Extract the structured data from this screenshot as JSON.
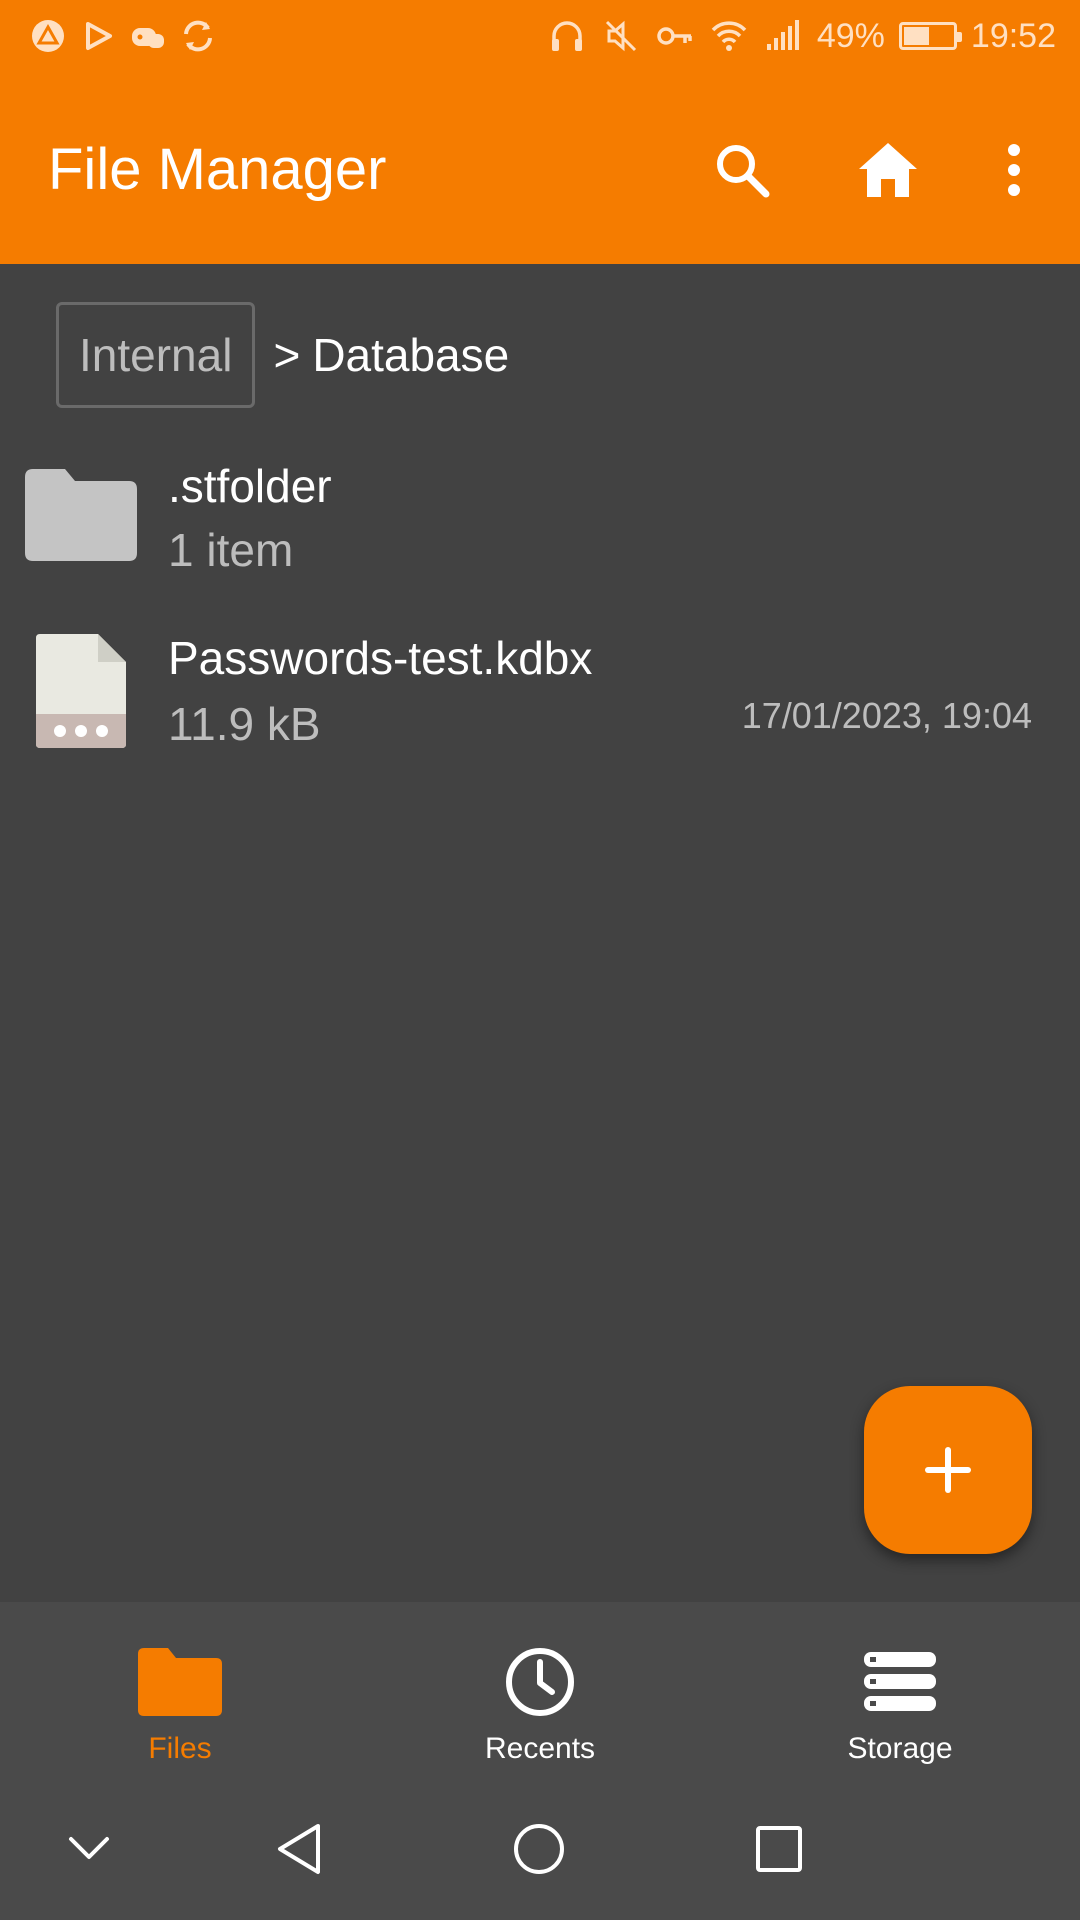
{
  "status_bar": {
    "battery_percent": "49%",
    "battery_level": 0.49,
    "time": "19:52",
    "left_icons": [
      "drive-icon",
      "play-icon",
      "game-icon",
      "sync-icon"
    ],
    "right_icons": [
      "headphones-icon",
      "mute-icon",
      "vpn-key-icon",
      "wifi-icon",
      "signal-icon",
      "battery-icon"
    ]
  },
  "app_bar": {
    "title": "File Manager",
    "actions": [
      "search-icon",
      "home-icon",
      "more-vert-icon"
    ],
    "color": "#F57C00"
  },
  "breadcrumb": {
    "root": "Internal",
    "separator": ">",
    "current": "Database"
  },
  "files": [
    {
      "name": ".stfolder",
      "meta": "1 item",
      "date": "",
      "icon": "folder-icon"
    },
    {
      "name": "Passwords-test.kdbx",
      "meta": "11.9 kB",
      "date": "17/01/2023, 19:04",
      "icon": "file-icon"
    }
  ],
  "fab": {
    "icon": "plus-icon"
  },
  "bottom_nav": {
    "items": [
      {
        "label": "Files",
        "icon": "folder-icon",
        "active": true
      },
      {
        "label": "Recents",
        "icon": "clock-icon",
        "active": false
      },
      {
        "label": "Storage",
        "icon": "storage-icon",
        "active": false
      }
    ],
    "active_color": "#F57C00"
  },
  "system_nav": [
    "chevron-down-icon",
    "back-icon",
    "home-circle-icon",
    "recents-square-icon"
  ]
}
